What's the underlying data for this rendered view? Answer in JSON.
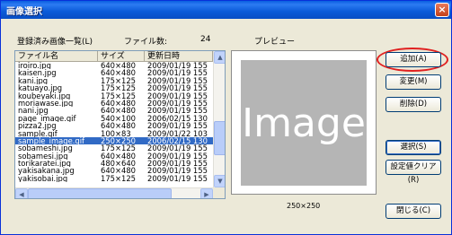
{
  "window": {
    "title": "画像選択",
    "close": "×"
  },
  "info": {
    "registered_label": "登録済み画像一覧(L)",
    "file_count_label": "ファイル数:",
    "file_count": "24",
    "preview_label": "プレビュー"
  },
  "list": {
    "headers": [
      "ファイル名",
      "サイズ",
      "更新日時"
    ],
    "rows": [
      [
        "iroiro.jpg",
        "640×480",
        "2009/01/19 155"
      ],
      [
        "kaisen.jpg",
        "640×480",
        "2009/01/19 155"
      ],
      [
        "kani.jpg",
        "175×125",
        "2009/01/19 155"
      ],
      [
        "katuayo.jpg",
        "175×125",
        "2009/01/19 155"
      ],
      [
        "koubeyaki.jpg",
        "175×125",
        "2009/01/19 155"
      ],
      [
        "moriawase.jpg",
        "640×480",
        "2009/01/19 155"
      ],
      [
        "nani.jpg",
        "640×480",
        "2009/01/19 155"
      ],
      [
        "page_image.gif",
        "540×100",
        "2006/02/15 130"
      ],
      [
        "pizza2.jpg",
        "640×480",
        "2009/01/19 155"
      ],
      [
        "sample.gif",
        "100×83",
        "2009/01/22 103"
      ],
      [
        "sample_image.gif",
        "250×250",
        "2006/02/15 130"
      ],
      [
        "sobameshi.jpg",
        "175×125",
        "2009/01/19 155"
      ],
      [
        "sobamesi.jpg",
        "640×480",
        "2009/01/19 155"
      ],
      [
        "torikaratei.jpg",
        "480×640",
        "2009/01/19 155"
      ],
      [
        "yakisakana.jpg",
        "640×480",
        "2009/01/19 155"
      ],
      [
        "yakisobai.jpg",
        "175×125",
        "2009/01/19 155"
      ]
    ],
    "selected_index": 10
  },
  "preview": {
    "image_text": "Image",
    "size": "250×250"
  },
  "buttons": {
    "add": "追加(A)",
    "change": "変更(M)",
    "delete": "削除(D)",
    "select": "選択(S)",
    "clear": "設定値クリア(R)",
    "close": "閉じる(C)"
  },
  "colors": {
    "selection": "#316ac5",
    "highlight_ring": "#e02020",
    "titlebar": "#0a5ad8"
  }
}
